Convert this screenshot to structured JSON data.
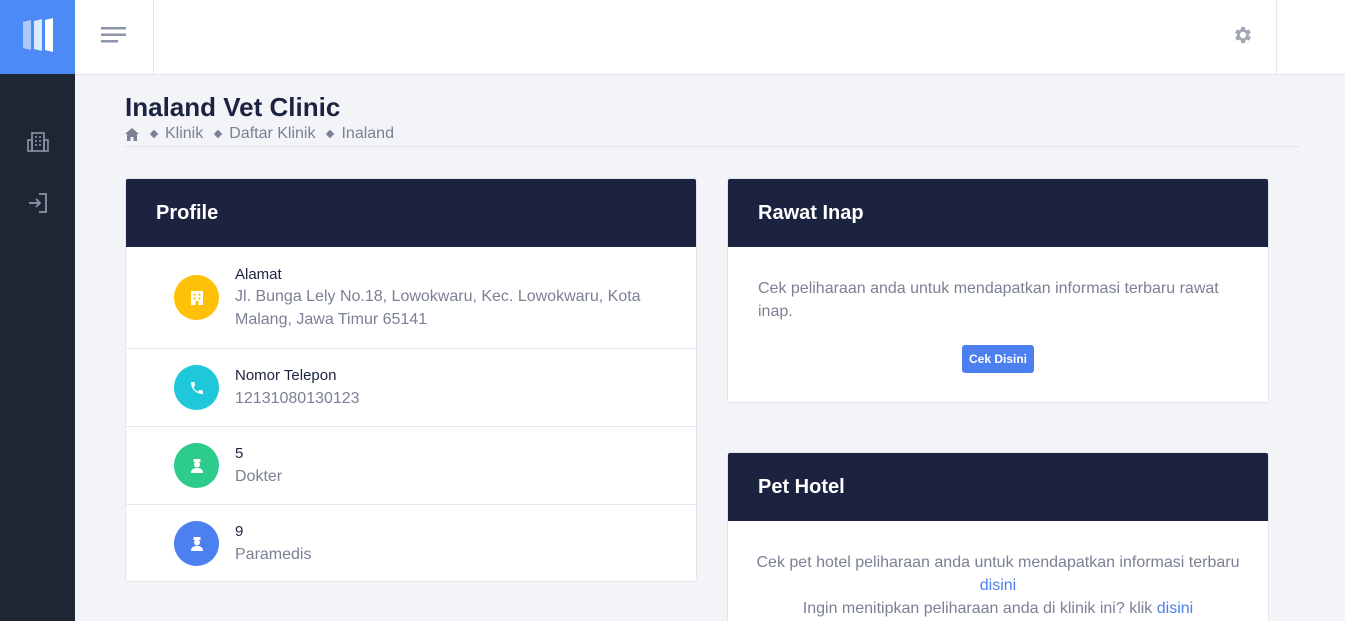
{
  "sidebar": {
    "logo_icon": "app-logo-icon",
    "items": [
      {
        "icon": "building-icon"
      },
      {
        "icon": "login-icon"
      }
    ]
  },
  "topbar": {
    "menu_icon": "hamburger-icon",
    "settings_icon": "gear-icon"
  },
  "page": {
    "title": "Inaland Vet Clinic",
    "breadcrumb": [
      "Klinik",
      "Daftar Klinik",
      "Inaland"
    ]
  },
  "profile": {
    "header": "Profile",
    "rows": [
      {
        "title": "Alamat",
        "value": "Jl. Bunga Lely No.18, Lowokwaru, Kec. Lowokwaru, Kota Malang, Jawa Timur 65141",
        "icon": "building-icon"
      },
      {
        "title": "Nomor Telepon",
        "value": "12131080130123",
        "icon": "phone-icon"
      },
      {
        "title": "5",
        "value": "Dokter",
        "icon": "doctor-icon"
      },
      {
        "title": "9",
        "value": "Paramedis",
        "icon": "paramedic-icon"
      }
    ]
  },
  "rawat_inap": {
    "header": "Rawat Inap",
    "text": "Cek peliharaan anda untuk mendapatkan informasi terbaru rawat inap.",
    "button": "Cek Disini"
  },
  "pet_hotel": {
    "header": "Pet Hotel",
    "line1": "Cek pet hotel peliharaan anda untuk mendapatkan informasi terbaru",
    "link1": "disini",
    "line2": "Ingin menitipkan peliharaan anda di klinik ini? klik",
    "link2": "disini"
  },
  "colors": {
    "accent": "#4c8bf5",
    "sidebar": "#1e2533",
    "card_header": "#1c2340",
    "yellow": "#ffc107",
    "cyan": "#1ec8da",
    "green": "#2dcb8c",
    "blue": "#4c7ff0"
  }
}
